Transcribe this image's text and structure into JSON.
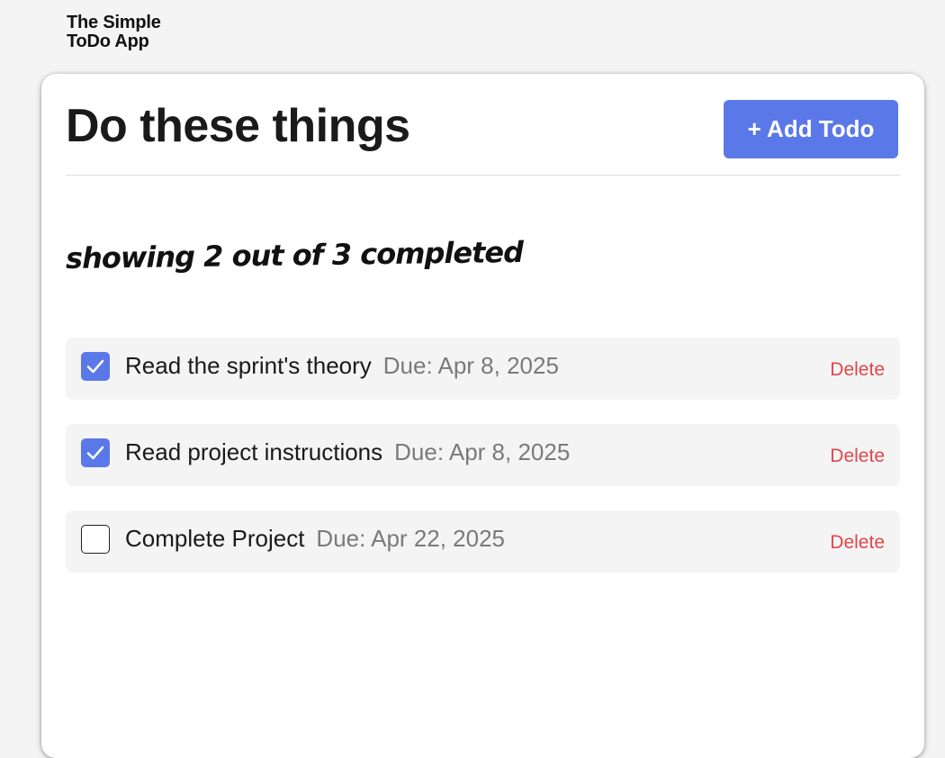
{
  "app": {
    "logo_line1": "The Simple",
    "logo_line2": "ToDo App"
  },
  "header": {
    "title": "Do these things",
    "add_button_label": "+ Add Todo"
  },
  "status": {
    "text": "showing 2 out of 3 completed"
  },
  "todos": [
    {
      "title": "Read the sprint's theory",
      "due": "Due: Apr 8, 2025",
      "completed": true,
      "delete_label": "Delete"
    },
    {
      "title": "Read project instructions",
      "due": "Due: Apr 8, 2025",
      "completed": true,
      "delete_label": "Delete"
    },
    {
      "title": "Complete Project",
      "due": "Due: Apr 22, 2025",
      "completed": false,
      "delete_label": "Delete"
    }
  ],
  "colors": {
    "accent": "#5a78e8",
    "delete": "#e0474c",
    "item_bg": "#f4f4f4",
    "page_bg": "#f4f4f4"
  },
  "icons": {
    "checkbox_checked": "checkmark-icon"
  }
}
